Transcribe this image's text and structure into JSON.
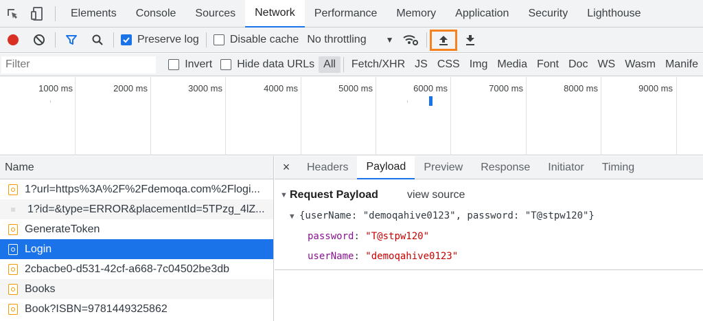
{
  "main_tabs": [
    "Elements",
    "Console",
    "Sources",
    "Network",
    "Performance",
    "Memory",
    "Application",
    "Security",
    "Lighthouse"
  ],
  "active_tab": "Network",
  "toolbar": {
    "preserve_log": "Preserve log",
    "disable_cache": "Disable cache",
    "throttling": "No throttling"
  },
  "filter": {
    "placeholder": "Filter",
    "invert": "Invert",
    "hide_data_urls": "Hide data URLs",
    "types": [
      "All",
      "Fetch/XHR",
      "JS",
      "CSS",
      "Img",
      "Media",
      "Font",
      "Doc",
      "WS",
      "Wasm",
      "Manife"
    ]
  },
  "timeline": {
    "labels": [
      "1000 ms",
      "2000 ms",
      "3000 ms",
      "4000 ms",
      "5000 ms",
      "6000 ms",
      "7000 ms",
      "8000 ms",
      "9000 ms"
    ]
  },
  "requests": {
    "header": "Name",
    "rows": [
      "1?url=https%3A%2F%2Fdemoqa.com%2Flogi...",
      "1?id=&type=ERROR&placementId=5TPzg_4lZ...",
      "GenerateToken",
      "Login",
      "2cbacbe0-d531-42cf-a668-7c04502be3db",
      "Books",
      "Book?ISBN=9781449325862"
    ]
  },
  "detail": {
    "close": "×",
    "tabs": [
      "Headers",
      "Payload",
      "Preview",
      "Response",
      "Initiator",
      "Timing"
    ],
    "active": "Payload"
  },
  "payload": {
    "title": "Request Payload",
    "view_source": "view source",
    "summary": "{userName: \"demoqahive0123\", password: \"T@stpw120\"}",
    "props": [
      {
        "key": "password",
        "value": "\"T@stpw120\""
      },
      {
        "key": "userName",
        "value": "\"demoqahive0123\""
      }
    ]
  },
  "colors": {
    "accent": "#1a73e8",
    "highlight": "#f5821f",
    "record": "#d93025"
  }
}
